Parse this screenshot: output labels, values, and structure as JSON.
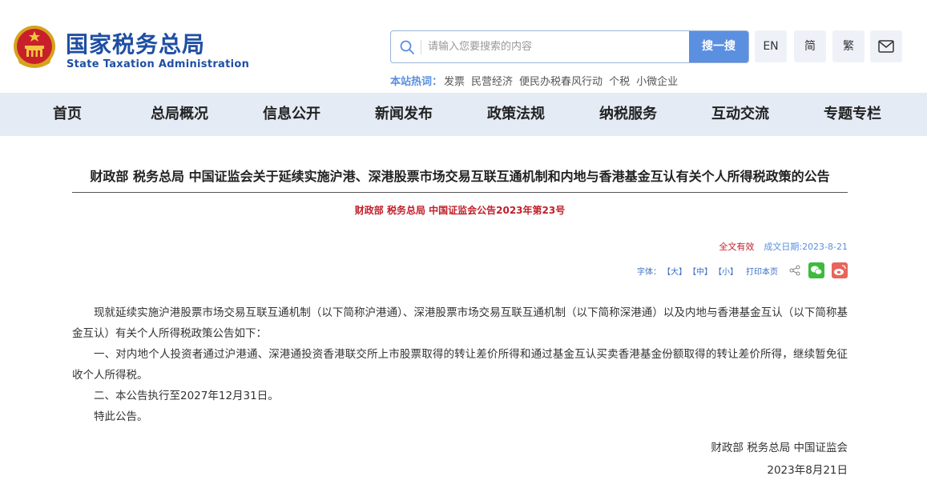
{
  "header": {
    "logo_cn": "国家税务总局",
    "logo_en": "State Taxation Administration",
    "emblem_icon": "national-emblem-icon",
    "search": {
      "placeholder": "请输入您要搜索的内容",
      "button": "搜一搜",
      "icon": "search-icon"
    },
    "lang": {
      "en": "EN",
      "simplified": "简",
      "traditional": "繁"
    },
    "mail_icon": "mail-icon",
    "hot": {
      "label": "本站热词：",
      "items": [
        "发票",
        "民营经济",
        "便民办税春风行动",
        "个税",
        "小微企业"
      ]
    }
  },
  "nav": {
    "items": [
      "首页",
      "总局概况",
      "信息公开",
      "新闻发布",
      "政策法规",
      "纳税服务",
      "互动交流",
      "专题专栏"
    ]
  },
  "article": {
    "title": "财政部 税务总局 中国证监会关于延续实施沪港、深港股票市场交易互联互通机制和内地与香港基金互认有关个人所得税政策的公告",
    "doc_number": "财政部 税务总局 中国证监会公告2023年第23号",
    "validity": "全文有效",
    "date": "成文日期:2023-8-21",
    "tools": {
      "font_label": "字体：",
      "large": "【大】",
      "medium": "【中】",
      "small": "【小】",
      "print": "打印本页",
      "share_icon": "share-icon",
      "wechat_icon": "wechat-icon",
      "weibo_icon": "weibo-icon"
    },
    "paragraphs": [
      "现就延续实施沪港股票市场交易互联互通机制（以下简称沪港通）、深港股票市场交易互联互通机制（以下简称深港通）以及内地与香港基金互认（以下简称基金互认）有关个人所得税政策公告如下：",
      "一、对内地个人投资者通过沪港通、深港通投资香港联交所上市股票取得的转让差价所得和通过基金互认买卖香港基金份额取得的转让差价所得，继续暂免征收个人所得税。",
      "二、本公告执行至2027年12月31日。",
      "特此公告。"
    ],
    "signature": "财政部  税务总局  中国证监会",
    "sign_date": "2023年8月21日"
  },
  "colors": {
    "brand_blue": "#1f4fa3",
    "accent_blue": "#5b8fe0",
    "nav_bg": "#e4ebf5",
    "red": "#c0202a"
  }
}
